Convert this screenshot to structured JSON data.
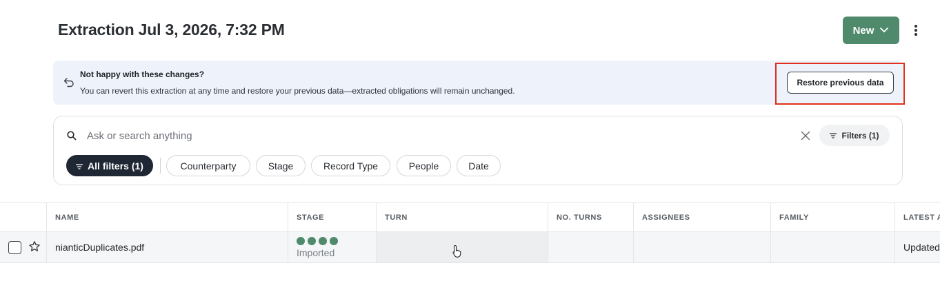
{
  "header": {
    "title": "Extraction Jul 3, 2026, 7:32 PM",
    "new_button": "New"
  },
  "banner": {
    "title": "Not happy with these changes?",
    "description": "You can revert this extraction at any time and restore your previous data—extracted obligations will remain unchanged.",
    "restore_button": "Restore previous data"
  },
  "search": {
    "placeholder": "Ask or search anything",
    "filters_button": "Filters (1)"
  },
  "filter_chips": [
    {
      "label": "All filters (1)",
      "active": true
    },
    {
      "label": "Counterparty"
    },
    {
      "label": "Stage"
    },
    {
      "label": "Record Type"
    },
    {
      "label": "People"
    },
    {
      "label": "Date"
    }
  ],
  "table": {
    "columns": [
      "NAME",
      "STAGE",
      "TURN",
      "NO. TURNS",
      "ASSIGNEES",
      "FAMILY",
      "LATEST A"
    ],
    "rows": [
      {
        "name": "nianticDuplicates.pdf",
        "stage": "Imported",
        "stage_progress": 4,
        "turn": "",
        "no_turns": "",
        "assignees": "",
        "family": "",
        "latest": "Updated"
      }
    ]
  },
  "colors": {
    "accent": "#4f8a6d",
    "banner_bg": "#edf2fb",
    "highlight": "#e0301e",
    "chip_active": "#1f2734"
  },
  "icons": [
    "kebab-menu-icon",
    "undo-icon",
    "search-icon",
    "close-icon",
    "filter-icon",
    "chevron-down-icon",
    "star-icon",
    "pointer-cursor-icon"
  ]
}
